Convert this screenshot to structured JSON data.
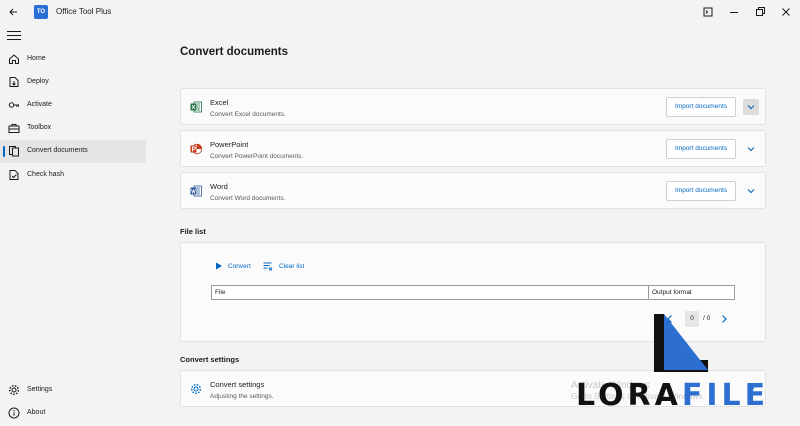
{
  "window": {
    "title": "Office Tool Plus",
    "logo_text": "TO"
  },
  "sidebar": {
    "items": [
      {
        "label": "Home",
        "icon": "home-icon"
      },
      {
        "label": "Deploy",
        "icon": "deploy-icon"
      },
      {
        "label": "Activate",
        "icon": "key-icon"
      },
      {
        "label": "Toolbox",
        "icon": "toolbox-icon"
      },
      {
        "label": "Convert documents",
        "icon": "convert-icon"
      },
      {
        "label": "Check hash",
        "icon": "check-hash-icon"
      }
    ],
    "footer_items": [
      {
        "label": "Settings",
        "icon": "gear-icon"
      },
      {
        "label": "About",
        "icon": "info-icon"
      }
    ],
    "active_index": 4
  },
  "main": {
    "title": "Convert documents",
    "converters": [
      {
        "name": "Excel",
        "desc": "Convert Excel documents.",
        "button": "Import documents",
        "color": "#1d7044"
      },
      {
        "name": "PowerPoint",
        "desc": "Convert PowerPoint documents.",
        "button": "Import documents",
        "color": "#c43e1c"
      },
      {
        "name": "Word",
        "desc": "Convert Word documents.",
        "button": "Import documents",
        "color": "#2b579a"
      }
    ],
    "file_list": {
      "heading": "File list",
      "convert_label": "Convert",
      "clear_label": "Clear list",
      "col_file": "File",
      "col_output": "Output format",
      "page_current": "0",
      "page_total": "/ 0"
    },
    "convert_settings": {
      "heading": "Convert settings",
      "title": "Convert settings",
      "desc": "Adjusting the settings."
    }
  },
  "overlay": {
    "activate_line1": "Activate Windows",
    "activate_line2": "Go to Settings to activate Windows.",
    "brand_dark": "LORA",
    "brand_blue": "FILE"
  },
  "colors": {
    "accent": "#0067c0",
    "brand_blue": "#2d6fd0"
  }
}
